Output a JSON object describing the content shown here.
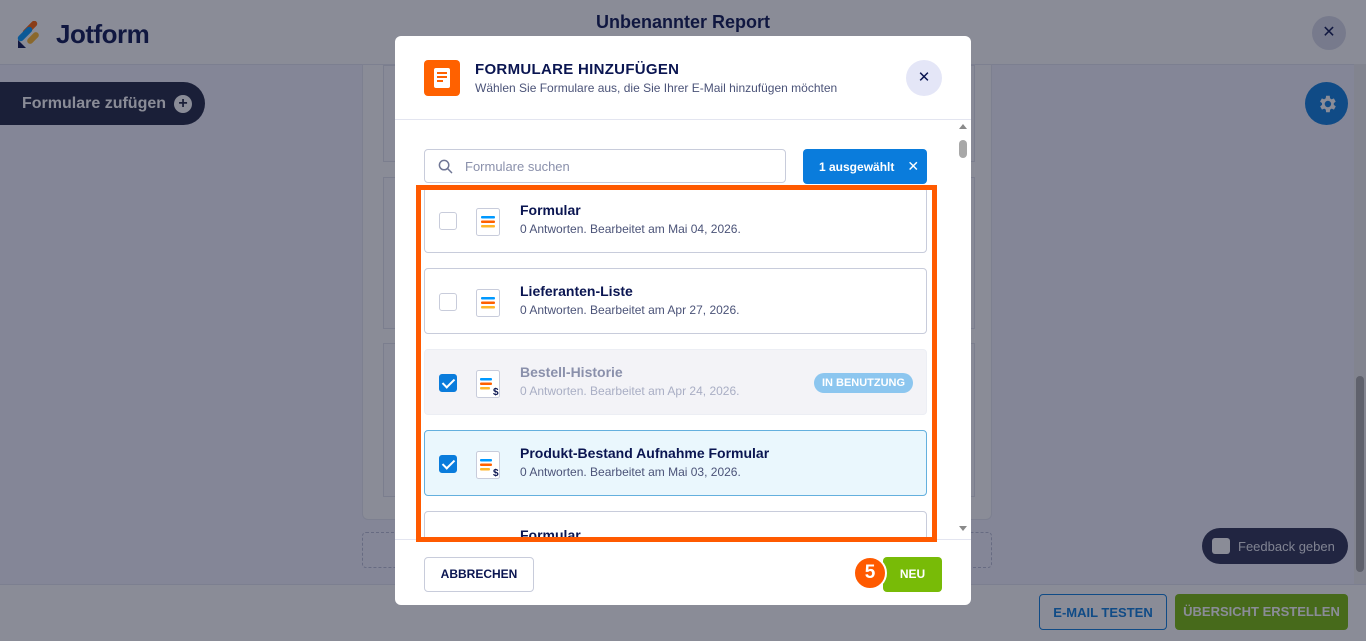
{
  "app": {
    "logo_text": "Jotform",
    "report_title": "Unbenannter Report",
    "add_forms_label": "Formulare zufügen",
    "feedback_label": "Feedback geben",
    "test_email_label": "E-MAIL TESTEN",
    "create_overview_label": "ÜBERSICHT ERSTELLEN"
  },
  "modal": {
    "title": "FORMULARE HINZUFÜGEN",
    "subtitle": "Wählen Sie Formulare aus, die Sie Ihrer E-Mail hinzufügen möchten",
    "search_placeholder": "Formulare suchen",
    "selected_label": "1 ausgewählt",
    "cancel_label": "ABBRECHEN",
    "new_label": "NEU",
    "step_number": "5",
    "items": [
      {
        "name": "Formular",
        "meta": "0 Antworten. Bearbeitet am Mai 04, 2026.",
        "checked": false,
        "state": "normal",
        "icon": "form-icon"
      },
      {
        "name": "Lieferanten-Liste",
        "meta": "0 Antworten. Bearbeitet am Apr 27, 2026.",
        "checked": false,
        "state": "normal",
        "icon": "form-icon"
      },
      {
        "name": "Bestell-Historie",
        "meta": "0 Antworten. Bearbeitet am Apr 24, 2026.",
        "checked": true,
        "state": "disabled",
        "badge": "IN BENUTZUNG",
        "icon": "payment-form-icon"
      },
      {
        "name": "Produkt-Bestand Aufnahme Formular",
        "meta": "0 Antworten. Bearbeitet am Mai 03, 2026.",
        "checked": true,
        "state": "active",
        "icon": "payment-form-icon"
      },
      {
        "name": "Formular",
        "meta": "",
        "checked": false,
        "state": "normal",
        "icon": "form-icon"
      }
    ]
  },
  "colors": {
    "brand_navy": "#0a1551",
    "primary_blue": "#0a7cdc",
    "green": "#78bb07",
    "orange": "#ff6100"
  }
}
